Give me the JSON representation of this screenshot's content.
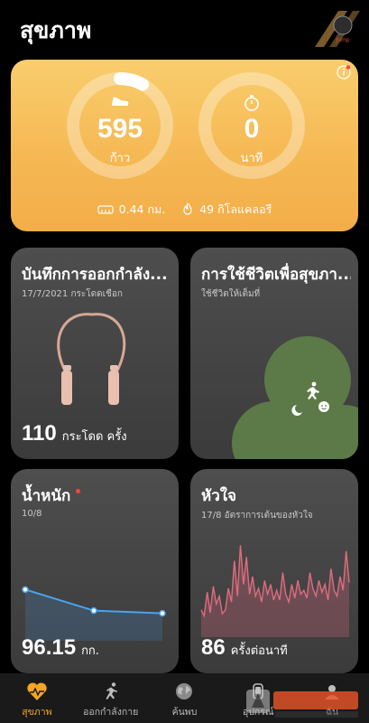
{
  "header": {
    "title": "สุขภาพ"
  },
  "summary": {
    "steps_value": "595",
    "steps_unit": "ก้าว",
    "steps_progress": 0.08,
    "minutes_value": "0",
    "minutes_unit": "นาที",
    "minutes_progress": 0,
    "distance": "0.44 กม.",
    "calories": "49 กิโลแคลอรี"
  },
  "tiles": {
    "exercise": {
      "title": "บันทึกการออกกำลัง...",
      "date": "17/7/2021 กระโดดเชือก",
      "value": "110",
      "unit": "กระโดด  ครั้ง"
    },
    "health": {
      "title": "การใช้ชีวิตเพื่อสุขภา...",
      "subtitle": "ใช้ชีวิตให้เต็มที่"
    },
    "weight": {
      "title": "น้ำหนัก",
      "date": "10/8",
      "value": "96.15",
      "unit": "กก.",
      "trend": [
        96.6,
        96.2,
        96.15
      ]
    },
    "heart": {
      "title": "หัวใจ",
      "date": "17/8 อัตราการเต้นของหัวใจ",
      "value": "86",
      "unit": "ครั้งต่อนาที",
      "trend": [
        70,
        64,
        88,
        67,
        94,
        76,
        84,
        66,
        70,
        92,
        78,
        120,
        84,
        136,
        96,
        124,
        86,
        104,
        84,
        92,
        78,
        100,
        86,
        96,
        80,
        90,
        80,
        108,
        86,
        78,
        96,
        82,
        100,
        86,
        90,
        82,
        108,
        92,
        84,
        100,
        88,
        96,
        80,
        112,
        90,
        84,
        104,
        90,
        130,
        98
      ]
    }
  },
  "nav": [
    {
      "label": "สุขภาพ",
      "icon": "heart-icon",
      "active": true
    },
    {
      "label": "ออกกำลังกาย",
      "icon": "runner-icon",
      "active": false
    },
    {
      "label": "ค้นพบ",
      "icon": "globe-icon",
      "active": false
    },
    {
      "label": "อุปกรณ์",
      "icon": "device-icon",
      "active": false
    },
    {
      "label": "ฉัน",
      "icon": "profile-icon",
      "active": false
    }
  ],
  "colors": {
    "accent": "#f6a623",
    "card_yellow": "#f5b954",
    "weight_line": "#4aa3f4",
    "heart_line": "#e06b80",
    "health_green": "#5c7a48"
  }
}
